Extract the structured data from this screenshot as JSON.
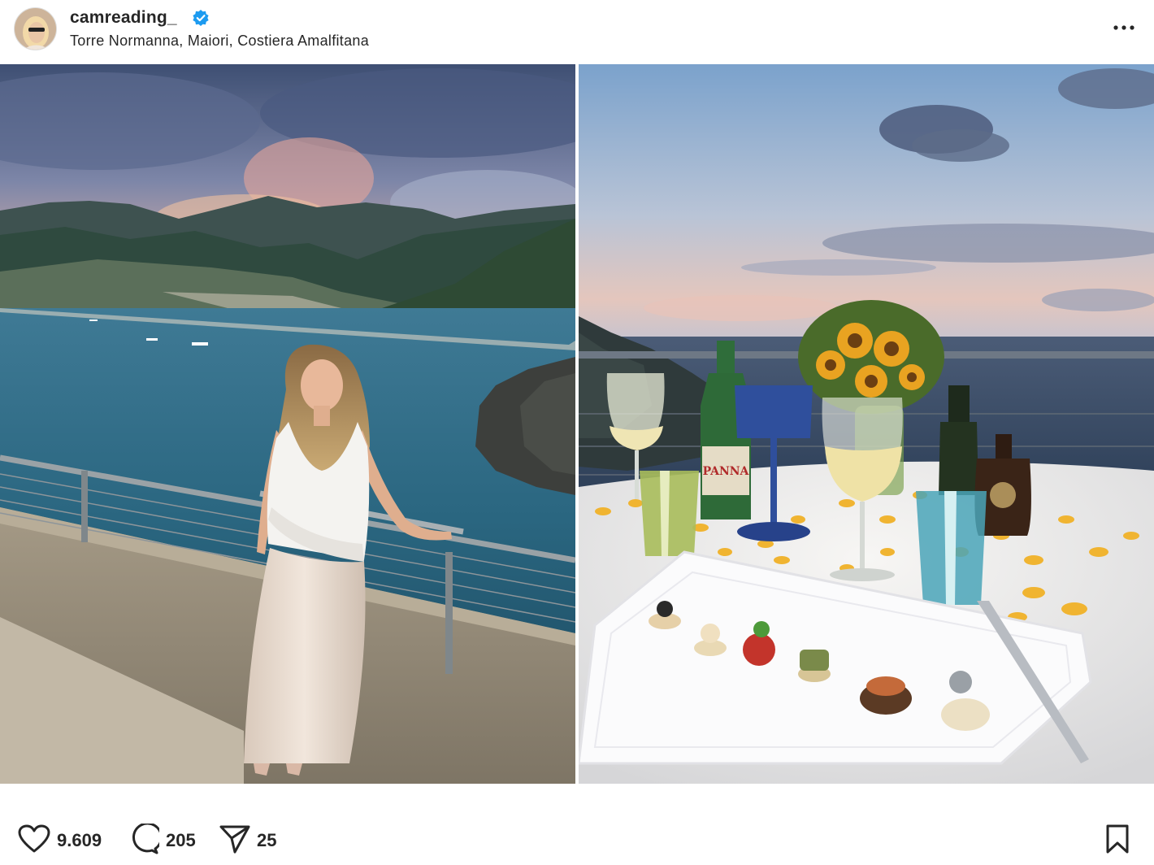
{
  "post": {
    "username": "camreading_",
    "verified": true,
    "location": "Torre Normanna, Maiori, Costiera Amalfitana"
  },
  "images": [
    {
      "name": "photo-woman-on-terrace",
      "icon": "photo"
    },
    {
      "name": "photo-dinner-table",
      "icon": "photo"
    }
  ],
  "actions": {
    "likes": "9.609",
    "comments": "205",
    "shares": "25"
  },
  "colors": {
    "verified": "#1d9bf0",
    "text": "#262626",
    "icon": "#262626"
  }
}
